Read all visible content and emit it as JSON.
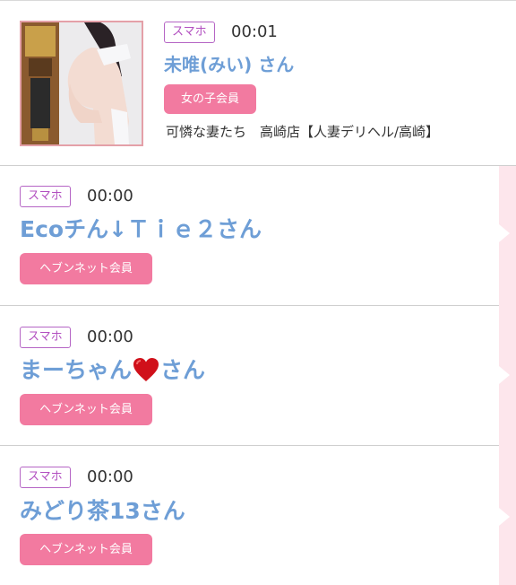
{
  "items": [
    {
      "device_badge": "スマホ",
      "time": "00:01",
      "name": "未唯(みい) さん",
      "member_badge": "女の子会員",
      "shop": "可憐な妻たち　高崎店【人妻デリヘル/高崎】",
      "has_photo": true
    },
    {
      "device_badge": "スマホ",
      "time": "00:00",
      "name_prefix": "Ecoチん↓Ｔｉｅ２さん",
      "member_badge": "ヘブンネット会員"
    },
    {
      "device_badge": "スマホ",
      "time": "00:00",
      "name_before_icon": "まーちゃん",
      "name_icon": "heart-icon",
      "name_after_icon": "さん",
      "member_badge": "ヘブンネット会員"
    },
    {
      "device_badge": "スマホ",
      "time": "00:00",
      "name": "みどり茶13さん",
      "member_badge": "ヘブンネット会員"
    }
  ],
  "colors": {
    "accent_pink": "#f27aa0",
    "name_blue": "#6e9ed6",
    "badge_purple": "#b24fc0",
    "side_band": "#fde6ec",
    "heart_red": "#d0101a"
  }
}
